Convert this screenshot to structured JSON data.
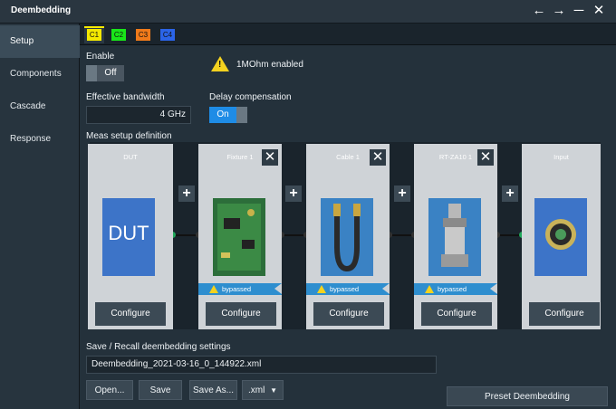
{
  "window": {
    "title": "Deembedding",
    "controls": [
      "back-arrow-icon",
      "forward-arrow-icon",
      "minimize-icon",
      "close-icon"
    ]
  },
  "sidebar": {
    "items": [
      {
        "label": "Setup",
        "active": true
      },
      {
        "label": "Components",
        "active": false
      },
      {
        "label": "Cascade",
        "active": false
      },
      {
        "label": "Response",
        "active": false
      }
    ]
  },
  "channels": [
    {
      "label": "C1",
      "color": "#f5e900",
      "active": true
    },
    {
      "label": "C2",
      "color": "#19e619",
      "active": false
    },
    {
      "label": "C3",
      "color": "#f07a1a",
      "active": false
    },
    {
      "label": "C4",
      "color": "#2b64e8",
      "active": false
    }
  ],
  "enable": {
    "label": "Enable",
    "state": "Off"
  },
  "warning": {
    "text": "1MOhm enabled"
  },
  "bandwidth": {
    "label": "Effective bandwidth",
    "value": "4 GHz"
  },
  "delay": {
    "label": "Delay compensation",
    "state": "On"
  },
  "meas": {
    "label": "Meas setup definition",
    "stages": [
      {
        "title": "DUT",
        "image": "dut-block",
        "closable": false,
        "bypassed": false,
        "button": "Configure"
      },
      {
        "title": "Fixture 1",
        "image": "pcb-board",
        "closable": true,
        "bypassed": true,
        "bypass_text": "bypassed",
        "button": "Configure"
      },
      {
        "title": "Cable 1",
        "image": "coax-cable",
        "closable": true,
        "bypassed": true,
        "bypass_text": "bypassed",
        "button": "Configure"
      },
      {
        "title": "RT-ZA10 1",
        "image": "bnc-adapter",
        "closable": true,
        "bypassed": true,
        "bypass_text": "bypassed",
        "button": "Configure"
      },
      {
        "title": "Input",
        "image": "scope-input",
        "closable": false,
        "bypassed": false,
        "button": "Configure"
      }
    ]
  },
  "file": {
    "label": "Save / Recall deembedding settings",
    "filename": "Deembedding_2021-03-16_0_144922.xml",
    "open": "Open...",
    "save": "Save",
    "save_as": "Save As...",
    "ext": ".xml",
    "preset": "Preset Deembedding"
  },
  "colors": {
    "accent": "#2e8ecf",
    "toggle_on": "#1e8ce6",
    "warning": "#f4d21f"
  }
}
